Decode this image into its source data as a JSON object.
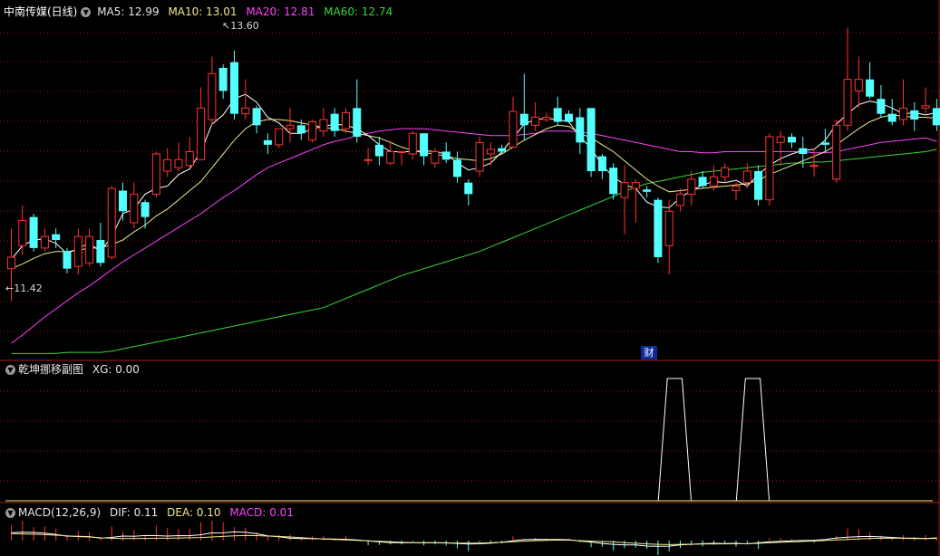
{
  "main_panel": {
    "stock_name": "中南传媒(日线)",
    "ma5": "MA5: 12.99",
    "ma10": "MA10: 13.01",
    "ma20": "MA20: 12.81",
    "ma60": "MA60: 12.74",
    "high_label": "13.60",
    "low_label": "11.42",
    "event_marker": "财"
  },
  "indicator_panel": {
    "name": "乾坤挪移副图",
    "xg": "XG: 0.00"
  },
  "macd_panel": {
    "name": "MACD(12,26,9)",
    "dif": "DIF: 0.11",
    "dea": "DEA: 0.10",
    "macd": "MACD: 0.01"
  },
  "colors": {
    "up": "#ff3232",
    "down": "#54ffff",
    "ma5": "#ffffff",
    "ma10": "#f0e88c",
    "ma20": "#ff40ff",
    "ma60": "#36d836",
    "grid": "#8a1a1a",
    "border": "#b01818"
  },
  "chart_data": [
    {
      "type": "candlestick",
      "title": "中南传媒(日线)",
      "price_range": [
        10.9,
        13.9
      ],
      "candles": [
        [
          11.7,
          11.8,
          11.42,
          12.05
        ],
        [
          11.9,
          12.12,
          11.82,
          12.25
        ],
        [
          12.15,
          11.88,
          11.85,
          12.18
        ],
        [
          11.88,
          11.98,
          11.85,
          12.05
        ],
        [
          12.0,
          11.95,
          11.88,
          12.05
        ],
        [
          11.85,
          11.7,
          11.66,
          11.88
        ],
        [
          11.72,
          11.98,
          11.65,
          12.05
        ],
        [
          11.75,
          11.98,
          11.72,
          12.05
        ],
        [
          11.95,
          11.75,
          11.72,
          12.1
        ],
        [
          11.8,
          12.4,
          11.78,
          12.42
        ],
        [
          12.38,
          12.2,
          12.12,
          12.45
        ],
        [
          12.1,
          12.35,
          12.05,
          12.45
        ],
        [
          12.28,
          12.15,
          12.05,
          12.3
        ],
        [
          12.35,
          12.7,
          12.32,
          12.72
        ],
        [
          12.55,
          12.65,
          12.5,
          12.75
        ],
        [
          12.58,
          12.65,
          12.55,
          12.8
        ],
        [
          12.6,
          12.72,
          12.58,
          12.85
        ],
        [
          12.65,
          13.1,
          12.65,
          13.28
        ],
        [
          13.0,
          13.4,
          12.95,
          13.55
        ],
        [
          13.45,
          13.25,
          13.18,
          13.48
        ],
        [
          13.5,
          13.05,
          13.0,
          13.6
        ],
        [
          13.05,
          13.1,
          13.0,
          13.35
        ],
        [
          13.1,
          12.95,
          12.88,
          13.12
        ],
        [
          12.82,
          12.78,
          12.7,
          12.88
        ],
        [
          12.78,
          12.92,
          12.75,
          12.92
        ],
        [
          12.92,
          12.95,
          12.8,
          13.1
        ],
        [
          12.95,
          12.88,
          12.82,
          13.0
        ],
        [
          12.82,
          12.98,
          12.8,
          13.0
        ],
        [
          12.9,
          13.0,
          12.85,
          13.1
        ],
        [
          13.05,
          12.9,
          12.85,
          13.1
        ],
        [
          12.92,
          13.06,
          12.88,
          13.1
        ],
        [
          13.1,
          12.85,
          12.8,
          13.35
        ],
        [
          12.65,
          12.65,
          12.6,
          12.75
        ],
        [
          12.78,
          12.68,
          12.6,
          12.85
        ],
        [
          12.62,
          12.72,
          12.6,
          12.82
        ],
        [
          12.72,
          12.72,
          12.6,
          12.72
        ],
        [
          12.7,
          12.88,
          12.65,
          12.9
        ],
        [
          12.88,
          12.68,
          12.6,
          12.88
        ],
        [
          12.62,
          12.72,
          12.58,
          12.75
        ],
        [
          12.72,
          12.65,
          12.62,
          12.8
        ],
        [
          12.65,
          12.5,
          12.45,
          12.72
        ],
        [
          12.45,
          12.35,
          12.25,
          12.48
        ],
        [
          12.55,
          12.8,
          12.5,
          12.85
        ],
        [
          12.7,
          12.74,
          12.6,
          12.8
        ],
        [
          12.75,
          12.72,
          12.7,
          12.78
        ],
        [
          12.76,
          13.07,
          12.75,
          13.2
        ],
        [
          13.05,
          12.95,
          12.82,
          13.4
        ],
        [
          12.95,
          13.02,
          12.9,
          13.15
        ],
        [
          13.0,
          13.02,
          12.98,
          13.06
        ],
        [
          13.1,
          12.98,
          12.95,
          13.2
        ],
        [
          13.05,
          12.98,
          12.97,
          13.08
        ],
        [
          13.02,
          12.8,
          12.7,
          13.1
        ],
        [
          13.1,
          12.55,
          12.5,
          13.1
        ],
        [
          12.68,
          12.55,
          12.48,
          12.7
        ],
        [
          12.58,
          12.35,
          12.3,
          12.62
        ],
        [
          12.32,
          12.45,
          12.0,
          12.6
        ],
        [
          12.4,
          12.45,
          12.1,
          12.48
        ],
        [
          12.39,
          12.37,
          12.32,
          12.42
        ],
        [
          12.3,
          11.8,
          11.75,
          12.32
        ],
        [
          11.9,
          12.2,
          11.65,
          12.3
        ],
        [
          12.25,
          12.35,
          12.2,
          12.4
        ],
        [
          12.35,
          12.48,
          12.25,
          12.55
        ],
        [
          12.5,
          12.42,
          12.4,
          12.55
        ],
        [
          12.42,
          12.5,
          12.38,
          12.6
        ],
        [
          12.5,
          12.58,
          12.45,
          12.62
        ],
        [
          12.38,
          12.42,
          12.3,
          12.45
        ],
        [
          12.45,
          12.55,
          12.4,
          12.62
        ],
        [
          12.55,
          12.3,
          12.25,
          12.6
        ],
        [
          12.3,
          12.85,
          12.25,
          12.88
        ],
        [
          12.8,
          12.85,
          12.6,
          12.9
        ],
        [
          12.85,
          12.8,
          12.75,
          12.88
        ],
        [
          12.75,
          12.7,
          12.58,
          12.85
        ],
        [
          12.6,
          12.6,
          12.5,
          12.75
        ],
        [
          12.8,
          12.78,
          12.72,
          12.92
        ],
        [
          12.48,
          12.95,
          12.45,
          13.0
        ],
        [
          12.95,
          13.35,
          12.9,
          13.8
        ],
        [
          13.25,
          13.35,
          13.1,
          13.55
        ],
        [
          13.35,
          13.2,
          13.18,
          13.5
        ],
        [
          13.18,
          13.05,
          13.02,
          13.3
        ],
        [
          13.05,
          12.98,
          12.95,
          13.18
        ],
        [
          13.0,
          13.1,
          12.95,
          13.35
        ],
        [
          13.08,
          13.0,
          12.9,
          13.15
        ],
        [
          13.1,
          13.12,
          13.05,
          13.28
        ],
        [
          13.1,
          12.95,
          12.9,
          13.18
        ],
        [
          12.95,
          13.1,
          12.9,
          13.2
        ]
      ],
      "ma5": [
        11.78,
        11.9,
        11.95,
        11.96,
        11.92,
        11.83,
        11.88,
        11.92,
        11.85,
        11.98,
        12.18,
        12.22,
        12.35,
        12.4,
        12.42,
        12.52,
        12.57,
        12.72,
        12.96,
        13.04,
        13.18,
        13.22,
        13.15,
        13.02,
        12.97,
        12.88,
        12.88,
        12.92,
        12.94,
        12.96,
        12.95,
        12.92,
        12.86,
        12.78,
        12.72,
        12.72,
        12.72,
        12.73,
        12.72,
        12.7,
        12.62,
        12.56,
        12.58,
        12.62,
        12.72,
        12.84,
        12.96,
        13.0,
        13.01,
        13.0,
        12.98,
        12.85,
        12.75,
        12.6,
        12.5,
        12.43,
        12.4,
        12.28,
        12.24,
        12.23,
        12.32,
        12.38,
        12.43,
        12.46,
        12.45,
        12.47,
        12.42,
        12.52,
        12.6,
        12.66,
        12.7,
        12.73,
        12.74,
        12.82,
        12.96,
        13.05,
        13.13,
        13.16,
        13.14,
        13.1,
        13.05,
        13.06,
        13.04,
        13.06
      ],
      "ma10": [
        11.7,
        11.74,
        11.79,
        11.83,
        11.85,
        11.85,
        11.86,
        11.88,
        11.88,
        11.91,
        11.95,
        12.02,
        12.08,
        12.16,
        12.22,
        12.3,
        12.38,
        12.46,
        12.58,
        12.7,
        12.82,
        12.92,
        12.98,
        13.0,
        13.0,
        12.99,
        12.97,
        12.95,
        12.93,
        12.92,
        12.9,
        12.88,
        12.86,
        12.84,
        12.8,
        12.76,
        12.73,
        12.71,
        12.7,
        12.68,
        12.66,
        12.65,
        12.64,
        12.66,
        12.7,
        12.76,
        12.82,
        12.87,
        12.92,
        12.95,
        12.94,
        12.88,
        12.84,
        12.78,
        12.72,
        12.64,
        12.56,
        12.48,
        12.42,
        12.37,
        12.38,
        12.39,
        12.4,
        12.41,
        12.42,
        12.43,
        12.44,
        12.47,
        12.52,
        12.56,
        12.6,
        12.64,
        12.68,
        12.72,
        12.78,
        12.85,
        12.92,
        12.98,
        13.02,
        13.04,
        13.03,
        13.02,
        13.02,
        13.01
      ],
      "ma20": [
        11.05,
        11.12,
        11.2,
        11.28,
        11.35,
        11.42,
        11.49,
        11.55,
        11.62,
        11.69,
        11.76,
        11.82,
        11.88,
        11.94,
        12.0,
        12.06,
        12.12,
        12.18,
        12.25,
        12.32,
        12.38,
        12.45,
        12.52,
        12.58,
        12.62,
        12.66,
        12.7,
        12.74,
        12.78,
        12.81,
        12.83,
        12.86,
        12.88,
        12.9,
        12.91,
        12.92,
        12.92,
        12.92,
        12.91,
        12.9,
        12.89,
        12.88,
        12.87,
        12.86,
        12.86,
        12.86,
        12.87,
        12.88,
        12.9,
        12.9,
        12.9,
        12.89,
        12.88,
        12.86,
        12.84,
        12.82,
        12.8,
        12.78,
        12.76,
        12.74,
        12.72,
        12.72,
        12.71,
        12.71,
        12.72,
        12.72,
        12.72,
        12.72,
        12.72,
        12.72,
        12.72,
        12.72,
        12.71,
        12.71,
        12.72,
        12.74,
        12.76,
        12.78,
        12.8,
        12.81,
        12.82,
        12.83,
        12.84,
        12.81
      ],
      "ma60": [
        10.96,
        10.96,
        10.96,
        10.96,
        10.96,
        10.97,
        10.97,
        10.97,
        10.97,
        10.98,
        11.0,
        11.02,
        11.04,
        11.06,
        11.08,
        11.1,
        11.12,
        11.14,
        11.16,
        11.18,
        11.2,
        11.22,
        11.24,
        11.26,
        11.28,
        11.3,
        11.32,
        11.34,
        11.36,
        11.4,
        11.44,
        11.48,
        11.52,
        11.56,
        11.6,
        11.64,
        11.67,
        11.7,
        11.73,
        11.76,
        11.79,
        11.82,
        11.85,
        11.89,
        11.93,
        11.97,
        12.01,
        12.05,
        12.09,
        12.13,
        12.17,
        12.21,
        12.25,
        12.29,
        12.33,
        12.37,
        12.41,
        12.44,
        12.46,
        12.48,
        12.5,
        12.52,
        12.54,
        12.55,
        12.56,
        12.57,
        12.58,
        12.59,
        12.6,
        12.61,
        12.62,
        12.62,
        12.63,
        12.63,
        12.64,
        12.65,
        12.66,
        12.67,
        12.68,
        12.69,
        12.7,
        12.71,
        12.72,
        12.74
      ]
    },
    {
      "type": "line",
      "title": "乾坤挪移副图",
      "xg_signal_bars": [
        59,
        60,
        66,
        67
      ],
      "xg_value": 0.0
    },
    {
      "type": "bar",
      "title": "MACD(12,26,9)",
      "dif": 0.11,
      "dea": 0.1,
      "macd": 0.01
    }
  ]
}
